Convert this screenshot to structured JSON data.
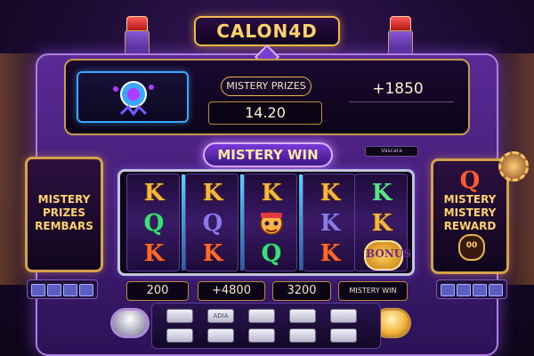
{
  "title": "CALON4D",
  "top_panel": {
    "prize_label": "MISTERY PRIZES",
    "prize_value": "14.20",
    "bonus": "+1850"
  },
  "banner": "MISTERY WIN",
  "small_tag": "Vascara",
  "left_panel": {
    "line1": "MISTERY",
    "line2": "PRIZES",
    "line3": "REMBARS"
  },
  "right_panel": {
    "line1": "MISTERY",
    "line2": "MISTERY",
    "line3": "REWARD",
    "top_symbol": "Q",
    "badge": "00"
  },
  "reels": [
    {
      "symbols": [
        {
          "text": "K",
          "color": "gold"
        },
        {
          "text": "Q",
          "color": "green"
        },
        {
          "text": "K",
          "color": "orange"
        }
      ]
    },
    {
      "symbols": [
        {
          "text": "K",
          "color": "gold"
        },
        {
          "text": "Q",
          "color": "purple"
        },
        {
          "text": "K",
          "color": "orange"
        }
      ]
    },
    {
      "symbols": [
        {
          "text": "K",
          "color": "gold"
        },
        {
          "text": "",
          "color": "character"
        },
        {
          "text": "Q",
          "color": "green"
        }
      ]
    },
    {
      "symbols": [
        {
          "text": "K",
          "color": "gold"
        },
        {
          "text": "K",
          "color": "purple"
        },
        {
          "text": "K",
          "color": "orange"
        }
      ]
    },
    {
      "symbols": [
        {
          "text": "K",
          "color": "lightgreen"
        },
        {
          "text": "K",
          "color": "gold"
        },
        {
          "text": "",
          "color": "orb"
        }
      ]
    }
  ],
  "bottom_values": [
    "200",
    "+4800",
    "3200",
    "MISTERY WIN"
  ],
  "orb_text": "BONUS",
  "keypad": {
    "row1": [
      "",
      "ADIA",
      "",
      "",
      ""
    ],
    "row2": [
      "",
      "",
      "",
      "",
      ""
    ]
  },
  "colors": {
    "gold": "#f5b83a",
    "accent_purple": "#7a3ad8",
    "frame_gold": "#d4a24a"
  }
}
